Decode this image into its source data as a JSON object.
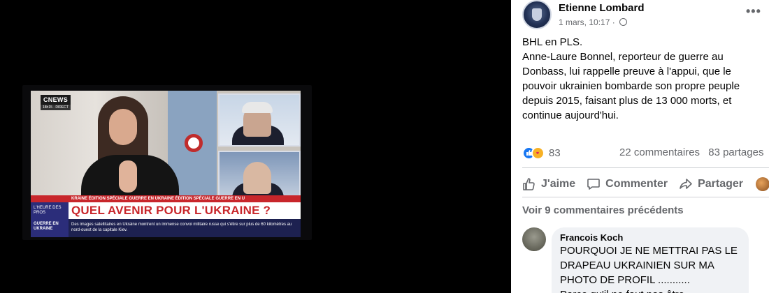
{
  "tv": {
    "channel": "CNEWS",
    "channel_sub": "18h15 · DIRECT",
    "ticker": "KRAINE   ÉDITION SPÉCIALE   GUERRE EN UKRAINE   ÉDITION SPÉCIALE   GUERRE EN U",
    "show_tag": "L'HEURE DES PROS",
    "headline": "QUEL AVENIR POUR L'UKRAINE ?",
    "info_tag": "GUERRE EN UKRAINE",
    "info_text": "Des images satellitaires en Ukraine montrent un immense convoi militaire russe qui s'étire sur plus de 60 kilomètres au nord-ouest de la capitale Kiev."
  },
  "post": {
    "author": "Etienne Lombard",
    "timestamp": "1 mars, 10:17 ·",
    "more_label": "•••",
    "body_line1": "BHL en PLS.",
    "body_line2": "Anne-Laure Bonnel, reporteur de guerre au Donbass, lui rappelle preuve à l'appui, que le pouvoir ukrainien bombarde son propre peuple depuis 2015, faisant plus de 13 000 morts, et continue aujourd'hui.",
    "reaction_count": "83",
    "comments_count": "22 commentaires",
    "shares_count": "83 partages",
    "like_label": "J'aime",
    "comment_label": "Commenter",
    "share_label": "Partager",
    "previous_comments": "Voir 9 commentaires précédents",
    "comment": {
      "name": "Francois Koch",
      "text": "POURQUOI JE NE METTRAI PAS LE DRAPEAU UKRAINIEN SUR MA PHOTO DE PROFIL ...........",
      "text_more": "Parce qu'il ne faut pas être"
    }
  },
  "colors": {
    "accent": "#1877f2",
    "secondary_text": "#65676b",
    "tv_red": "#c8262b",
    "tv_navy": "#2b2d7a"
  },
  "icons": [
    "globe-icon",
    "like-icon",
    "love-reaction-icon",
    "thumbs-up-icon",
    "comment-icon",
    "share-icon",
    "more-icon"
  ]
}
